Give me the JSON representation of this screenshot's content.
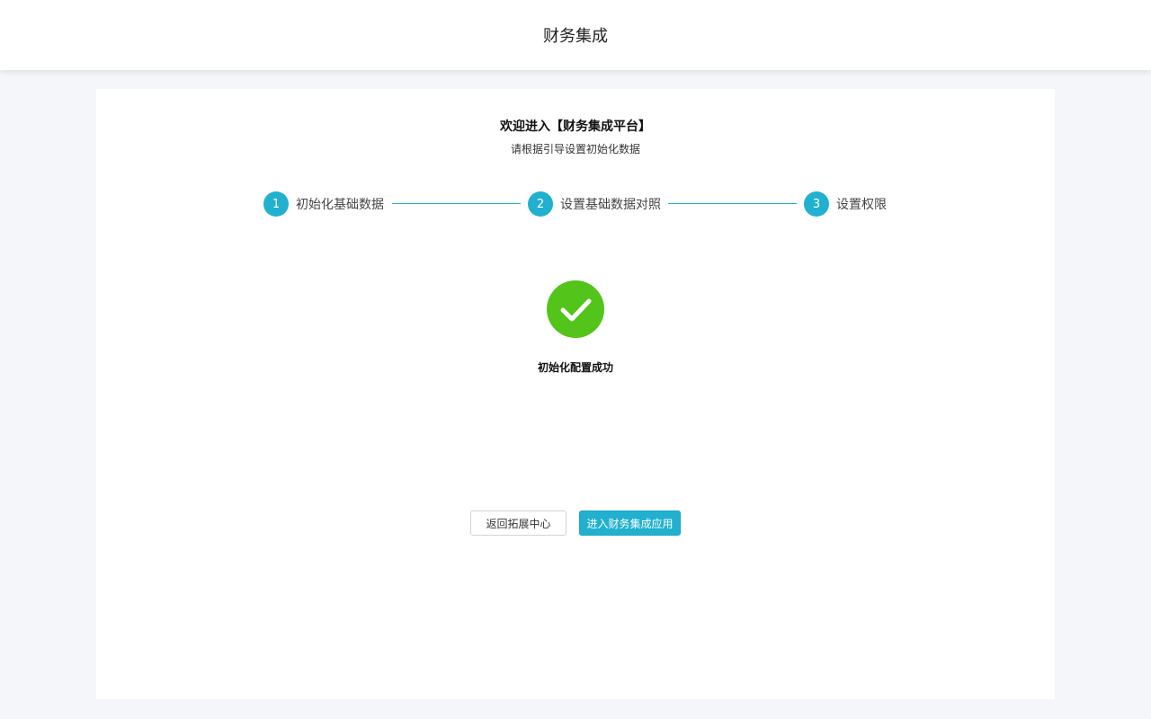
{
  "header": {
    "title": "财务集成"
  },
  "welcome": {
    "title": "欢迎进入【财务集成平台】",
    "subtitle": "请根据引导设置初始化数据"
  },
  "steps": [
    {
      "number": "1",
      "label": "初始化基础数据"
    },
    {
      "number": "2",
      "label": "设置基础数据对照"
    },
    {
      "number": "3",
      "label": "设置权限"
    }
  ],
  "result": {
    "icon": "check-circle-icon",
    "message": "初始化配置成功",
    "color": "#52c41a"
  },
  "actions": {
    "back_label": "返回拓展中心",
    "enter_label": "进入财务集成应用"
  },
  "theme": {
    "accent": "#21b1cf",
    "success": "#52c41a",
    "background": "#f4f6f9"
  }
}
